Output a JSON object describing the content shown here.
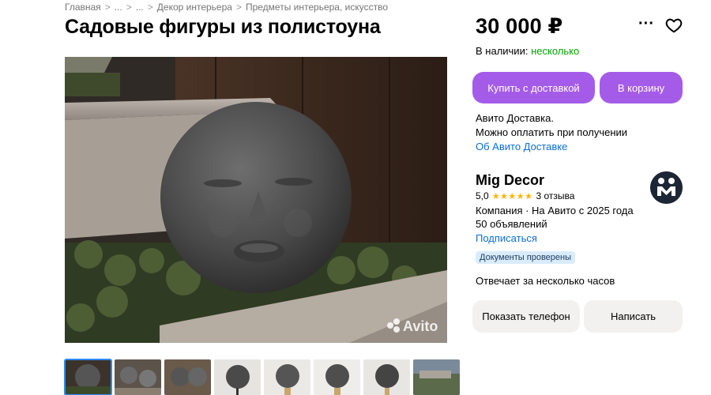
{
  "breadcrumb": {
    "items": [
      "Главная",
      "...",
      "...",
      "Декор интерьера",
      "Предметы интерьера, искусство"
    ],
    "separator": ">"
  },
  "listing": {
    "title": "Садовые фигуры из полистоуна",
    "price": "30 000 ₽",
    "availability_label": "В наличии:",
    "availability_value": "несколько"
  },
  "actions": {
    "buy_with_delivery": "Купить с доставкой",
    "add_to_cart": "В корзину",
    "show_phone": "Показать телефон",
    "write": "Написать"
  },
  "delivery": {
    "line1": "Авито Доставка.",
    "line2": "Можно оплатить при получении",
    "link": "Об Авито Доставке"
  },
  "seller": {
    "name": "Mig Decor",
    "rating": "5,0",
    "stars": "★★★★★",
    "reviews": "3 отзыва",
    "type": "Компания · На Авито с 2025 года",
    "listings": "50 объявлений",
    "subscribe": "Подписаться",
    "verified_badge": "Документы проверены",
    "response_time": "Отвечает за несколько часов"
  },
  "gallery": {
    "watermark": "Avito",
    "thumbnail_count": 8
  },
  "icons": {
    "more": "more-dots-icon",
    "favorite": "heart-icon"
  },
  "colors": {
    "accent_purple": "#a45ce8",
    "available_green": "#02a800",
    "link_blue": "#0a6fd6",
    "star_yellow": "#ffb400",
    "badge_blue": "#d9ecfd"
  }
}
